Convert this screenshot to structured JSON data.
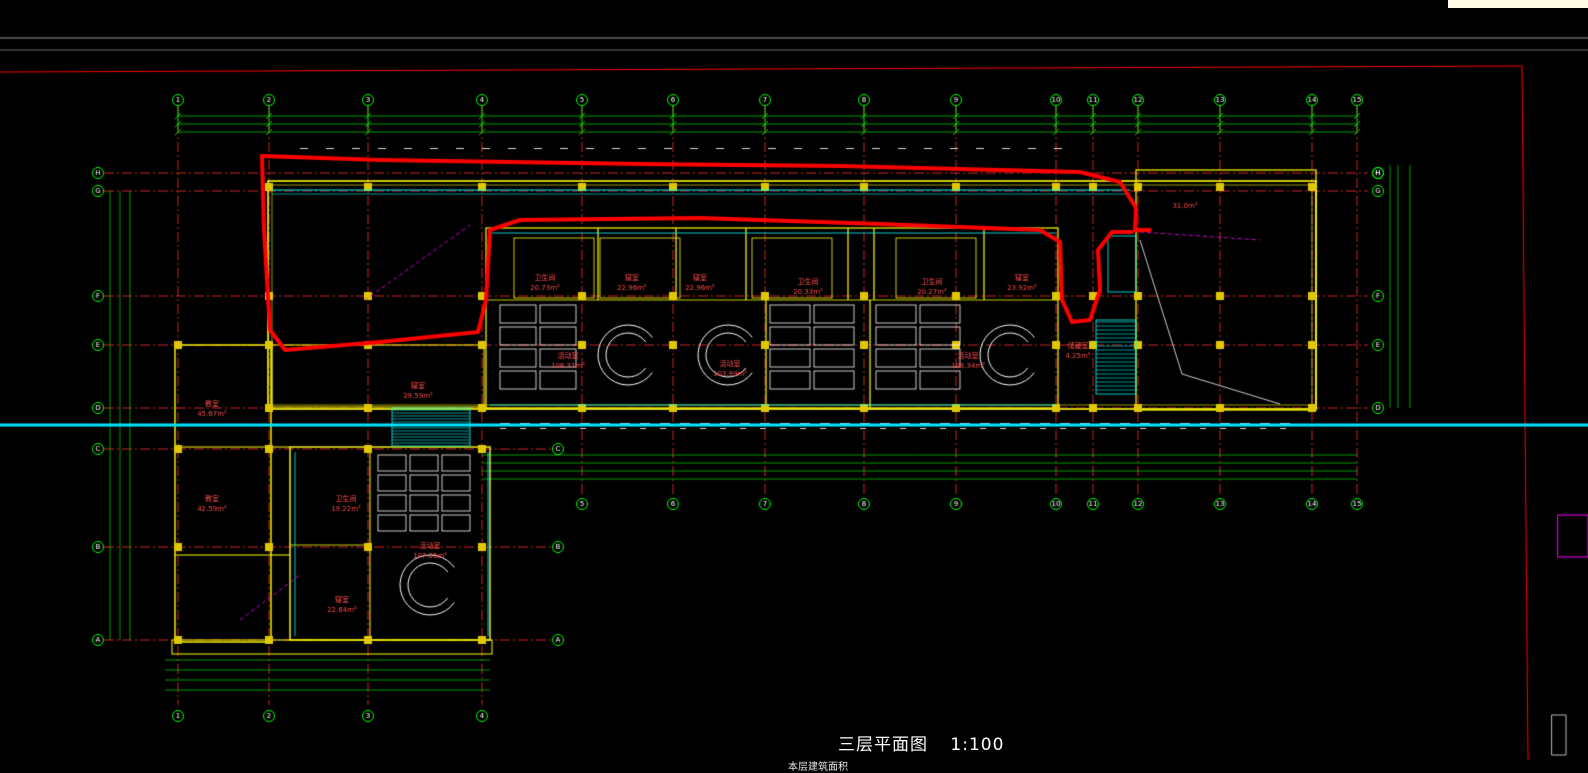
{
  "drawing": {
    "title": "三层平面图",
    "scale": "1:100",
    "subtitle_partial": "本层建筑面积"
  },
  "axis_labels": {
    "columns": [
      "1",
      "2",
      "3",
      "4",
      "5",
      "6",
      "7",
      "8",
      "9",
      "10",
      "11",
      "12",
      "13",
      "14",
      "15"
    ],
    "rows": [
      "A",
      "B",
      "C",
      "D",
      "E",
      "F",
      "G",
      "H"
    ]
  },
  "room_labels": [
    {
      "name": "活动室",
      "area": "108.31m²"
    },
    {
      "name": "活动室",
      "area": "103.99m²"
    },
    {
      "name": "活动室",
      "area": "108.34m²"
    },
    {
      "name": "活动室",
      "area": "107.85m²"
    },
    {
      "name": "寝室",
      "area": "22.96m²"
    },
    {
      "name": "寝室",
      "area": "22.96m²"
    },
    {
      "name": "寝室",
      "area": "23.92m²"
    },
    {
      "name": "寝室",
      "area": "29.59m²"
    },
    {
      "name": "寝室",
      "area": "22.64m²"
    },
    {
      "name": "卫生间",
      "area": "20.73m²"
    },
    {
      "name": "卫生间",
      "area": "20.33m²"
    },
    {
      "name": "卫生间",
      "area": "20.27m²"
    },
    {
      "name": "卫生间",
      "area": "19.22m²"
    },
    {
      "name": "教室",
      "area": "45.67m²"
    },
    {
      "name": "教室",
      "area": "42.59m²"
    },
    {
      "name": "储藏室",
      "area": "4.25m²"
    },
    {
      "name": "",
      "area": "31.0m²"
    }
  ],
  "colors": {
    "background": "#000000",
    "grid": "#00ff00",
    "walls": "#ffff00",
    "axis_line": "#ff3030",
    "markup": "#ff0000",
    "section_line": "#00e5ff",
    "text": "#ffffff",
    "room_text": "#ff4d4d",
    "glass": "#00ffff",
    "furniture": "#ffffff",
    "accent": "#ff00ff"
  }
}
